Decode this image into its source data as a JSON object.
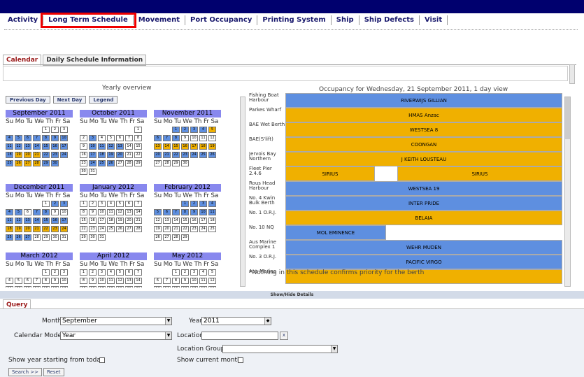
{
  "nav": [
    "Activity",
    "Long Term Schedule",
    "Movement",
    "Port Occupancy",
    "Printing System",
    "Ship",
    "Ship Defects",
    "Visit"
  ],
  "nav_active_index": 1,
  "tabs": [
    "Calendar",
    "Daily Schedule Information"
  ],
  "left": {
    "title": "Yearly overview",
    "buttons": [
      "Previous Day",
      "Next Day",
      "Legend"
    ],
    "dow": "Su Mo Tu We Th Fr Sa",
    "months": [
      "September 2011",
      "October 2011",
      "November 2011",
      "December 2011",
      "January 2012",
      "February 2012",
      "March 2012",
      "April 2012",
      "May 2012"
    ]
  },
  "right": {
    "title": "Occupancy for Wednesday, 21 September 2011, 1 day view",
    "rows": [
      {
        "label": "Fishing Boat Harbour",
        "bars": [
          {
            "text": "RIVERWIJS GILLIAN",
            "color": "blue"
          }
        ]
      },
      {
        "label": "Parkes Wharf",
        "bars": [
          {
            "text": "HMAS Anzac",
            "color": "orange"
          }
        ]
      },
      {
        "label": "BAE Wet Berth",
        "bars": [
          {
            "text": "WESTSEA 8",
            "color": "orange"
          }
        ]
      },
      {
        "label": "BAE(S'lift)",
        "bars": [
          {
            "text": "COONGAN",
            "color": "orange"
          }
        ]
      },
      {
        "label": "Jervois Bay Northern",
        "bars": [
          {
            "text": "J KEITH LOUSTEAU",
            "color": "orange"
          }
        ]
      },
      {
        "label": "Fleet Pier 2.4.6",
        "bars": [
          {
            "text": "SIRIUS",
            "color": "orange"
          },
          {
            "text": "SIRIUS",
            "color": "orange"
          }
        ]
      },
      {
        "label": "Rous Head Harbour",
        "bars": [
          {
            "text": "WESTSEA 19",
            "color": "blue"
          }
        ]
      },
      {
        "label": "No. 4 Kwin Bulk Berth",
        "bars": [
          {
            "text": "INTER PRIDE",
            "color": "blue"
          }
        ]
      },
      {
        "label": "No. 1 O.R.J.",
        "bars": [
          {
            "text": "BELAIA",
            "color": "orange"
          }
        ]
      },
      {
        "label": "No. 10 NQ",
        "bars": [
          {
            "text": "MOL EMINENCE",
            "color": "blue"
          }
        ]
      },
      {
        "label": "Aus Marine Complex 1",
        "bars": [
          {
            "text": "WEHR MUDEN",
            "color": "blue"
          }
        ]
      },
      {
        "label": "No. 3 O.R.J.",
        "bars": [
          {
            "text": "PACIFIC VIRGO",
            "color": "blue"
          }
        ]
      },
      {
        "label": "Aus Marine",
        "bars": [
          {
            "text": "",
            "color": "orange"
          }
        ]
      }
    ],
    "note": "*Nothing in this schedule confirms priority for the berth"
  },
  "showhide": "Show/Hide Details",
  "query": {
    "tab": "Query",
    "month_label": "Month",
    "month_value": "September",
    "year_label": "Year",
    "year_value": "2011",
    "mode_label": "Calendar Mode",
    "mode_value": "Year",
    "location_label": "Location",
    "location_group_label": "Location Group",
    "show_year_label": "Show year starting from today",
    "show_month_label": "Show current month",
    "search_label": "Search >>",
    "reset_label": "Reset"
  },
  "colors": {
    "accent_blue": "#5e8fe0",
    "accent_orange": "#f0b000",
    "topbar": "#00006e",
    "highlight": "#e00000"
  }
}
